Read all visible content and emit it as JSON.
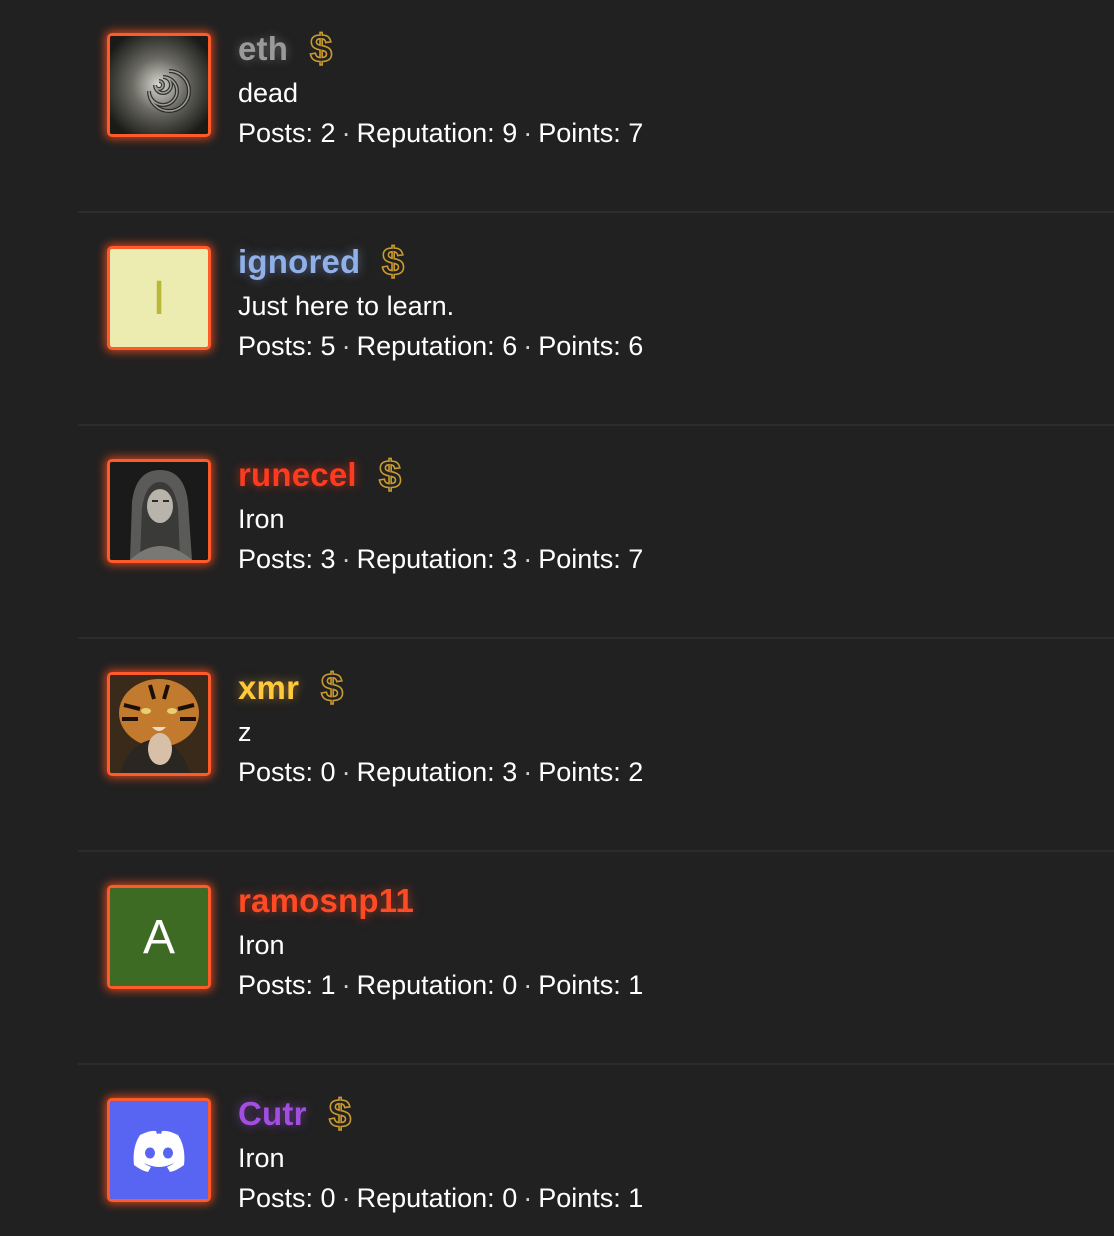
{
  "members": [
    {
      "username": "eth",
      "username_color": "#9a9a9a",
      "title": "dead",
      "has_dollar_badge": true,
      "avatar_type": "image",
      "avatar_icon": "spiral-image",
      "stats": {
        "posts_label": "Posts:",
        "posts": "2",
        "reputation_label": "Reputation:",
        "reputation": "9",
        "points_label": "Points:",
        "points": "7"
      }
    },
    {
      "username": "ignored",
      "username_color": "#8fb0e8",
      "title": "Just here to learn.",
      "has_dollar_badge": true,
      "avatar_type": "letter",
      "avatar_letter": "I",
      "avatar_bg": "#ecebb0",
      "avatar_fg": "#b9b73a",
      "stats": {
        "posts_label": "Posts:",
        "posts": "5",
        "reputation_label": "Reputation:",
        "reputation": "6",
        "points_label": "Points:",
        "points": "6"
      }
    },
    {
      "username": "runecel",
      "username_color": "#ff3a1e",
      "title": "Iron",
      "has_dollar_badge": true,
      "avatar_type": "image",
      "avatar_icon": "hooded-figure-image",
      "stats": {
        "posts_label": "Posts:",
        "posts": "3",
        "reputation_label": "Reputation:",
        "reputation": "3",
        "points_label": "Points:",
        "points": "7"
      }
    },
    {
      "username": "xmr",
      "username_color": "#ffc93a",
      "title": "z",
      "has_dollar_badge": true,
      "avatar_type": "image",
      "avatar_icon": "tiger-image",
      "stats": {
        "posts_label": "Posts:",
        "posts": "0",
        "reputation_label": "Reputation:",
        "reputation": "3",
        "points_label": "Points:",
        "points": "2"
      }
    },
    {
      "username": "ramosnp11",
      "username_color": "#ff4a24",
      "title": "Iron",
      "has_dollar_badge": false,
      "avatar_type": "letter",
      "avatar_letter": "A",
      "avatar_bg": "#3e6b24",
      "avatar_fg": "#ffffff",
      "stats": {
        "posts_label": "Posts:",
        "posts": "1",
        "reputation_label": "Reputation:",
        "reputation": "0",
        "points_label": "Points:",
        "points": "1"
      }
    },
    {
      "username": "Cutr",
      "username_color": "#a24ee0",
      "title": "Iron",
      "has_dollar_badge": true,
      "avatar_type": "discord",
      "avatar_icon": "discord-icon",
      "avatar_bg": "#5865f2",
      "stats": {
        "posts_label": "Posts:",
        "posts": "0",
        "reputation_label": "Reputation:",
        "reputation": "0",
        "points_label": "Points:",
        "points": "1"
      }
    }
  ]
}
